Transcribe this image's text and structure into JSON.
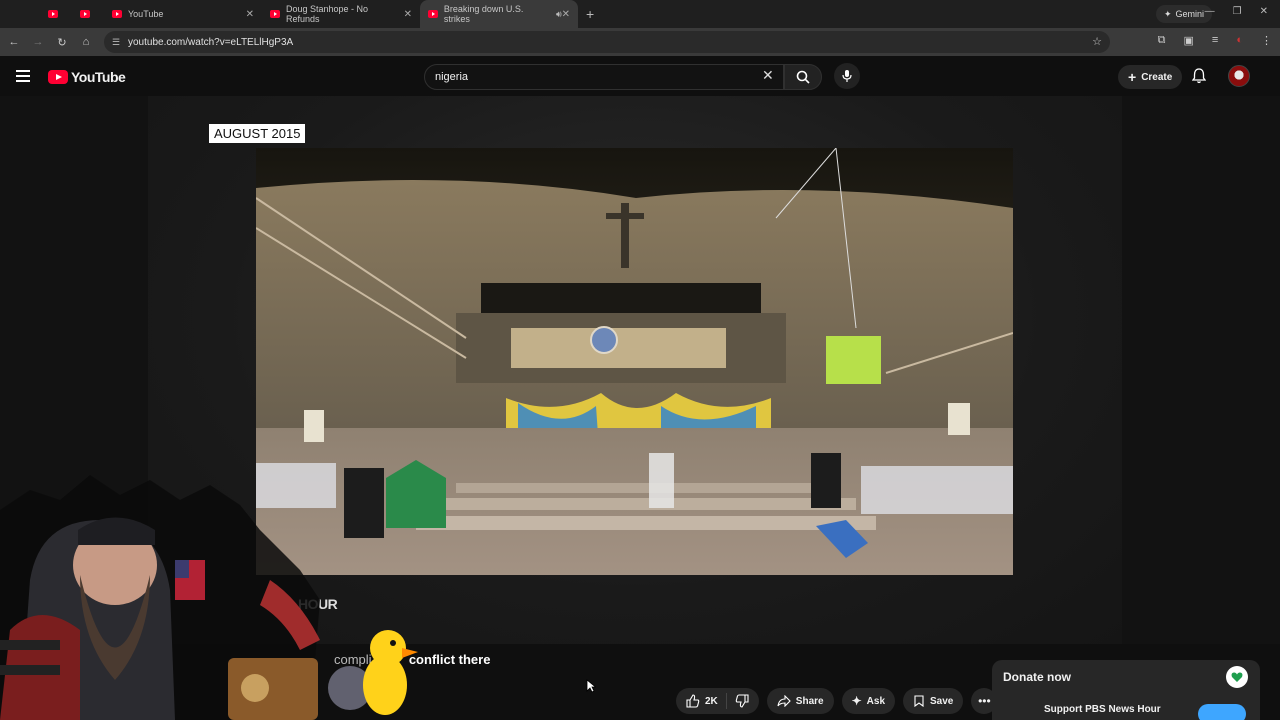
{
  "browser": {
    "tabs": [
      {
        "label": "",
        "closable": false
      },
      {
        "label": "",
        "closable": false
      },
      {
        "label": "YouTube",
        "closable": true
      },
      {
        "label": "Doug Stanhope - No Refunds",
        "closable": true
      },
      {
        "label": "Breaking down U.S. strikes",
        "closable": true,
        "active": true
      }
    ],
    "gemini_label": "Gemini",
    "url": "youtube.com/watch?v=eLTELlHgP3A"
  },
  "youtube": {
    "logo_text": "YouTube",
    "search_value": "nigeria",
    "create_label": "Create"
  },
  "video": {
    "date_label": "AUGUST 2015",
    "lower_third_fragment": "HOUR",
    "caption_prefix": "compli",
    "caption_main": "conflict there"
  },
  "actions": {
    "like_count": "2K",
    "share_label": "Share",
    "ask_label": "Ask",
    "save_label": "Save"
  },
  "donate": {
    "title": "Donate now",
    "subtitle": "Support PBS News Hour"
  },
  "colors": {
    "brand_red": "#ff0033",
    "accent_blue": "#3ea6ff",
    "bg": "#0f0f0f"
  }
}
